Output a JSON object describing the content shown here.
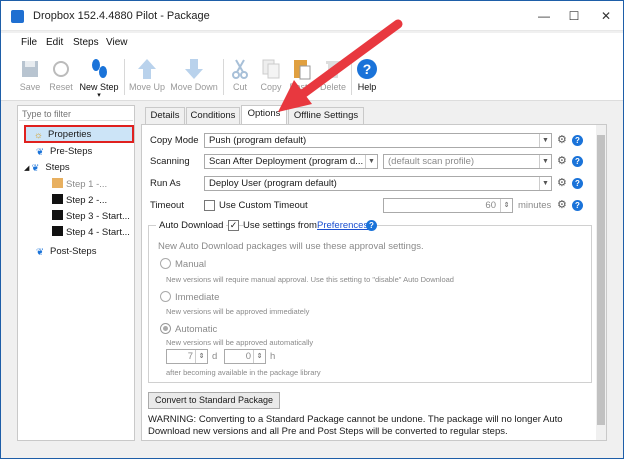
{
  "window": {
    "title": "Dropbox 152.4.4880 Pilot - Package",
    "minimize": "—",
    "maximize": "☐",
    "close": "✕"
  },
  "menu": [
    "File",
    "Edit",
    "Steps",
    "View"
  ],
  "toolbar": {
    "save": "Save",
    "reset": "Reset",
    "new_step": "New Step",
    "move_up": "Move Up",
    "move_down": "Move Down",
    "cut": "Cut",
    "copy": "Copy",
    "paste": "Paste",
    "delete": "Delete",
    "help": "Help"
  },
  "sidebar": {
    "filter_placeholder": "Type to filter",
    "items": [
      "Properties",
      "Pre-Steps",
      "Steps",
      "Step 1 -...",
      "Step 2 -...",
      "Step 3 - Start...",
      "Step 4 - Start...",
      "Post-Steps"
    ]
  },
  "tabs": [
    "Details",
    "Conditions",
    "Options",
    "Offline Settings"
  ],
  "options": {
    "copy_mode_label": "Copy Mode",
    "copy_mode_value": "Push (program default)",
    "scanning_label": "Scanning",
    "scanning_value": "Scan After Deployment (program d...",
    "scan_profile_placeholder": "(default scan profile)",
    "run_as_label": "Run As",
    "run_as_value": "Deploy User (program default)",
    "timeout_label": "Timeout",
    "use_custom_timeout": "Use Custom Timeout",
    "timeout_value": "60",
    "timeout_unit": "minutes",
    "auto_download_label": "Auto Download",
    "use_settings_from": "Use settings from",
    "preferences_link": "Preferences",
    "approval_note": "New Auto Download packages will use these approval settings.",
    "manual_label": "Manual",
    "manual_desc": "New versions will require manual approval. Use this setting to \"disable\" Auto Download",
    "immediate_label": "Immediate",
    "immediate_desc": "New versions will be approved immediately",
    "automatic_label": "Automatic",
    "automatic_desc": "New versions will be approved automatically",
    "days_value": "7",
    "days_unit": "d",
    "hours_value": "0",
    "hours_unit": "h",
    "after_library": "after becoming available in the package library",
    "convert_button": "Convert to Standard Package",
    "warning": "WARNING: Converting to a Standard Package cannot be undone. The package will no longer Auto Download new versions and all Pre and Post Steps will be converted to regular steps."
  },
  "colors": {
    "accent": "#1a73d9",
    "highlight": "#e0211f",
    "arrow": "#e8383f"
  }
}
